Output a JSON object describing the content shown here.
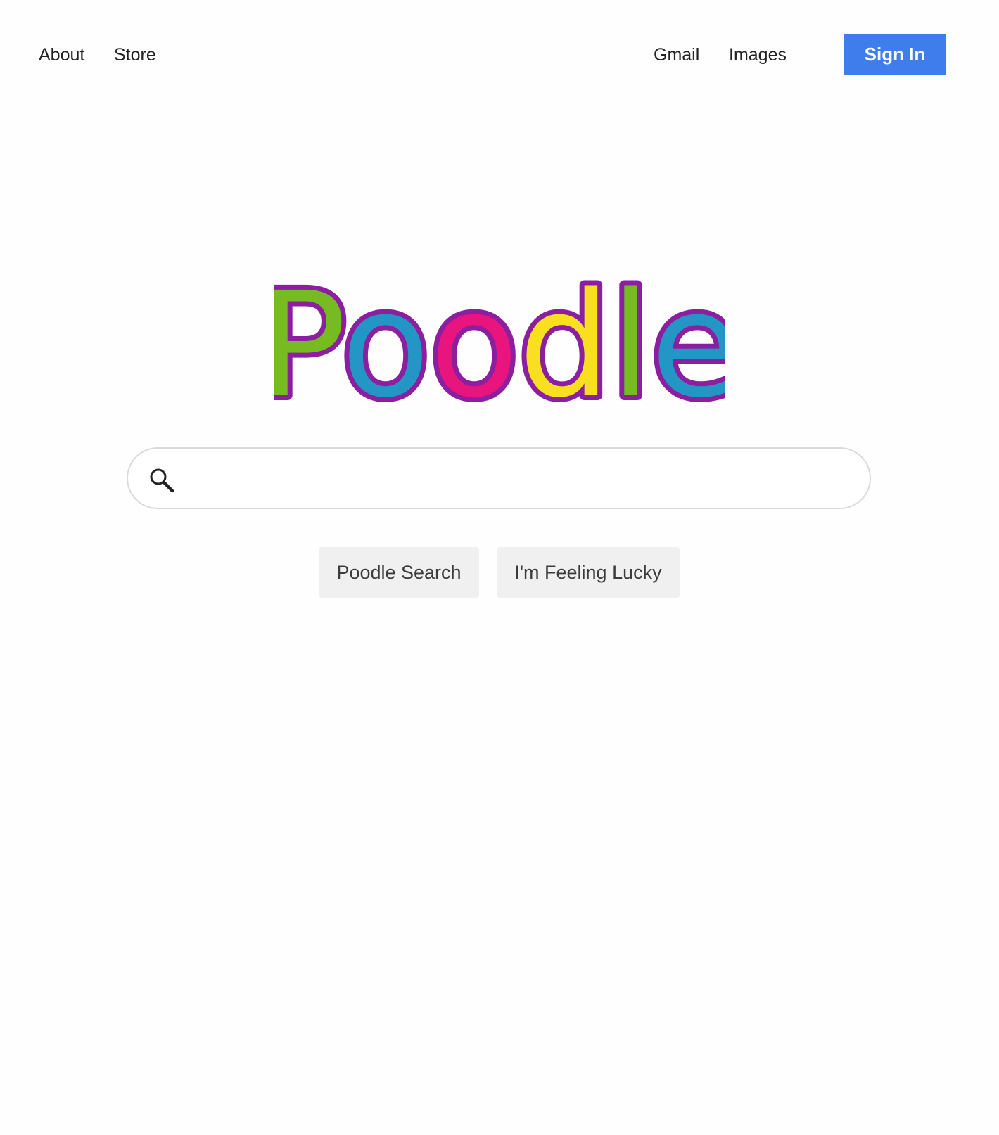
{
  "nav": {
    "left_links": [
      "About",
      "Store"
    ],
    "right_links": [
      "Gmail",
      "Images"
    ],
    "sign_in_label": "Sign In"
  },
  "logo": {
    "text": "Poodle",
    "letter_colors": [
      "#77bb22",
      "#2496c6",
      "#e8157e",
      "#f8e020",
      "#77bb22",
      "#2496c6"
    ],
    "outline_color": "#8b1fa0"
  },
  "search": {
    "value": "",
    "placeholder": "",
    "icon": "search-icon"
  },
  "buttons": {
    "search_label": "Poodle Search",
    "lucky_label": "I'm Feeling Lucky"
  },
  "colors": {
    "sign_in_bg": "#3f7ded",
    "button_bg": "#f0f0f0",
    "search_border": "#dadada"
  }
}
